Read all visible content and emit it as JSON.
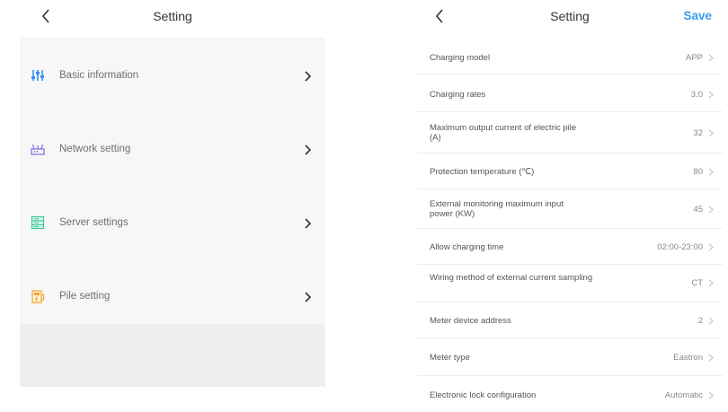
{
  "left": {
    "title": "Setting",
    "menu": [
      {
        "label": "Basic information",
        "icon": "sliders-icon",
        "color": "#3b8ff0"
      },
      {
        "label": "Network setting",
        "icon": "router-icon",
        "color": "#7a6ae0"
      },
      {
        "label": "Server settings",
        "icon": "server-icon",
        "color": "#3cc59b"
      },
      {
        "label": "Pile setting",
        "icon": "charging-pile-icon",
        "color": "#f0a83a"
      }
    ]
  },
  "right": {
    "title": "Setting",
    "save_label": "Save",
    "rows": [
      {
        "label": "Charging model",
        "value": "APP"
      },
      {
        "label": "Charging rates",
        "value": "3.0"
      },
      {
        "label": "Maximum output current of electric pile (A)",
        "value": "32"
      },
      {
        "label": "Protection temperature (℃)",
        "value": "80"
      },
      {
        "label": "External monitoring maximum input power (KW)",
        "value": "45"
      },
      {
        "label": "Allow charging time",
        "value": "02:00-23:00"
      },
      {
        "label": "Wiring method of external current sampling",
        "value": "CT"
      },
      {
        "label": "Meter device address",
        "value": "2"
      },
      {
        "label": "Meter type",
        "value": "Eastron"
      },
      {
        "label": "Electronic lock configuration",
        "value": "Automatic"
      }
    ]
  },
  "colors": {
    "accent": "#3b9bf0",
    "panel_bg": "#f7f7f8",
    "footer_bg": "#efeff0"
  }
}
